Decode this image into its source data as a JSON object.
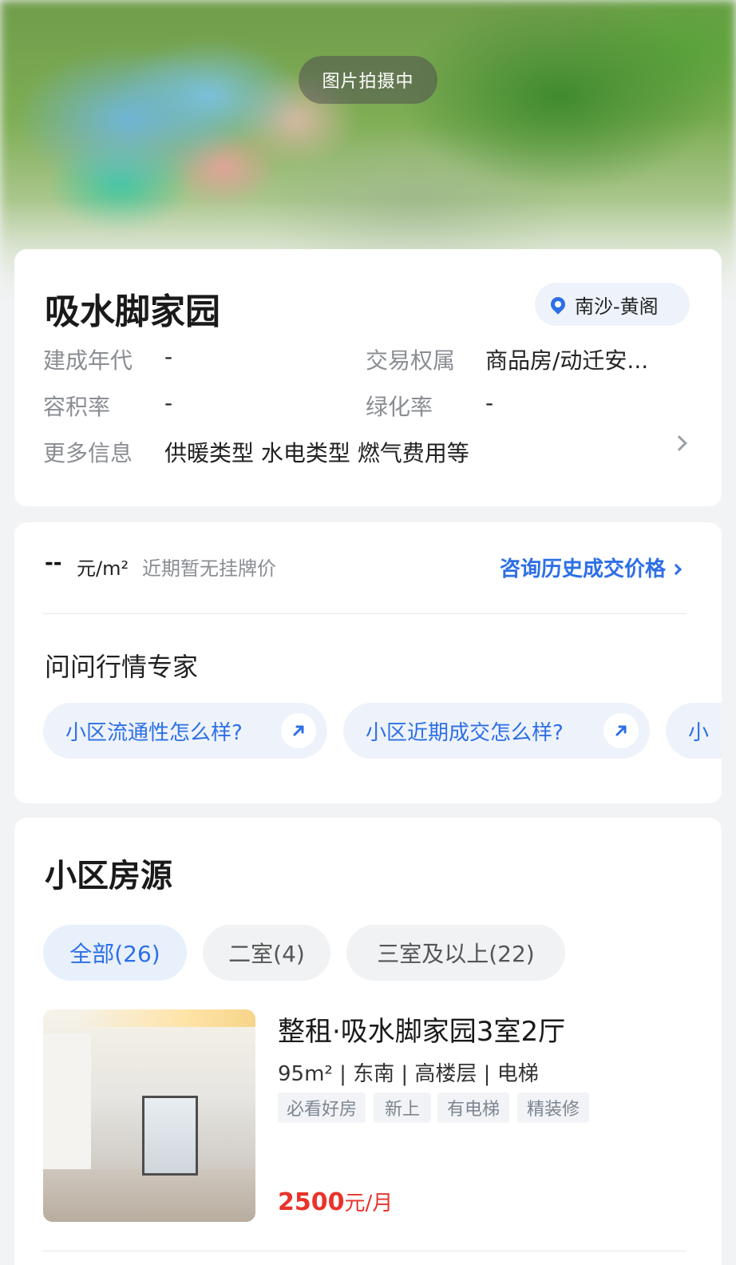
{
  "hero": {
    "photo_status": "图片拍摄中"
  },
  "community": {
    "name": "吸水脚家园",
    "location": "南沙-黄阁",
    "info": {
      "build_year_label": "建成年代",
      "build_year_value": "-",
      "ownership_label": "交易权属",
      "ownership_value": "商品房/动迁安...",
      "plot_ratio_label": "容积率",
      "plot_ratio_value": "-",
      "greening_label": "绿化率",
      "greening_value": "-",
      "more_label": "更多信息",
      "more_value": "供暖类型 水电类型 燃气费用等"
    }
  },
  "price": {
    "value": "--",
    "unit": "元/m²",
    "note": "近期暂无挂牌价",
    "consult_link": "咨询历史成交价格"
  },
  "expert": {
    "title": "问问行情专家",
    "questions": [
      {
        "text": "小区流通性怎么样?"
      },
      {
        "text": "小区近期成交怎么样?"
      },
      {
        "text": "小"
      }
    ]
  },
  "listings_section": {
    "title": "小区房源",
    "filters": [
      {
        "label": "全部(26)",
        "active": true
      },
      {
        "label": "二室(4)",
        "active": false
      },
      {
        "label": "三室及以上(22)",
        "active": false
      }
    ],
    "items": [
      {
        "title": "整租·吸水脚家园3室2厅",
        "meta": "95m² | 东南 | 高楼层 | 电梯",
        "tags": [
          "必看好房",
          "新上",
          "有电梯",
          "精装修"
        ],
        "price": "2500",
        "price_unit": "元/月"
      }
    ]
  },
  "colors": {
    "accent": "#2d6fe6",
    "price": "#e8332b",
    "chip_bg": "#eef3fb"
  }
}
